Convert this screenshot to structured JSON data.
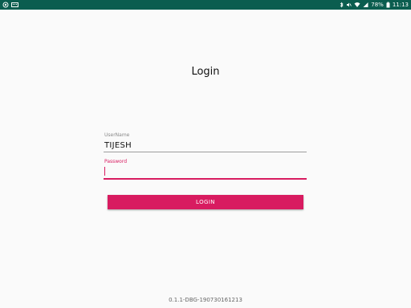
{
  "status_bar": {
    "left_icons": [
      "at-sign-icon",
      "keyboard-icon"
    ],
    "right_icons": [
      "bluetooth-icon",
      "mute-icon",
      "wifi-icon",
      "signal-icon"
    ],
    "battery_percent": "78%",
    "time": "11:13"
  },
  "login": {
    "title": "Login",
    "username": {
      "label": "UserName",
      "value": "TIJESH"
    },
    "password": {
      "label": "Password",
      "value": ""
    },
    "button_label": "LOGIN"
  },
  "footer": {
    "version": "0.1.1-DBG-190730161213"
  },
  "colors": {
    "status_bar": "#0b5d4f",
    "accent": "#d81b60",
    "background": "#fafafa"
  }
}
